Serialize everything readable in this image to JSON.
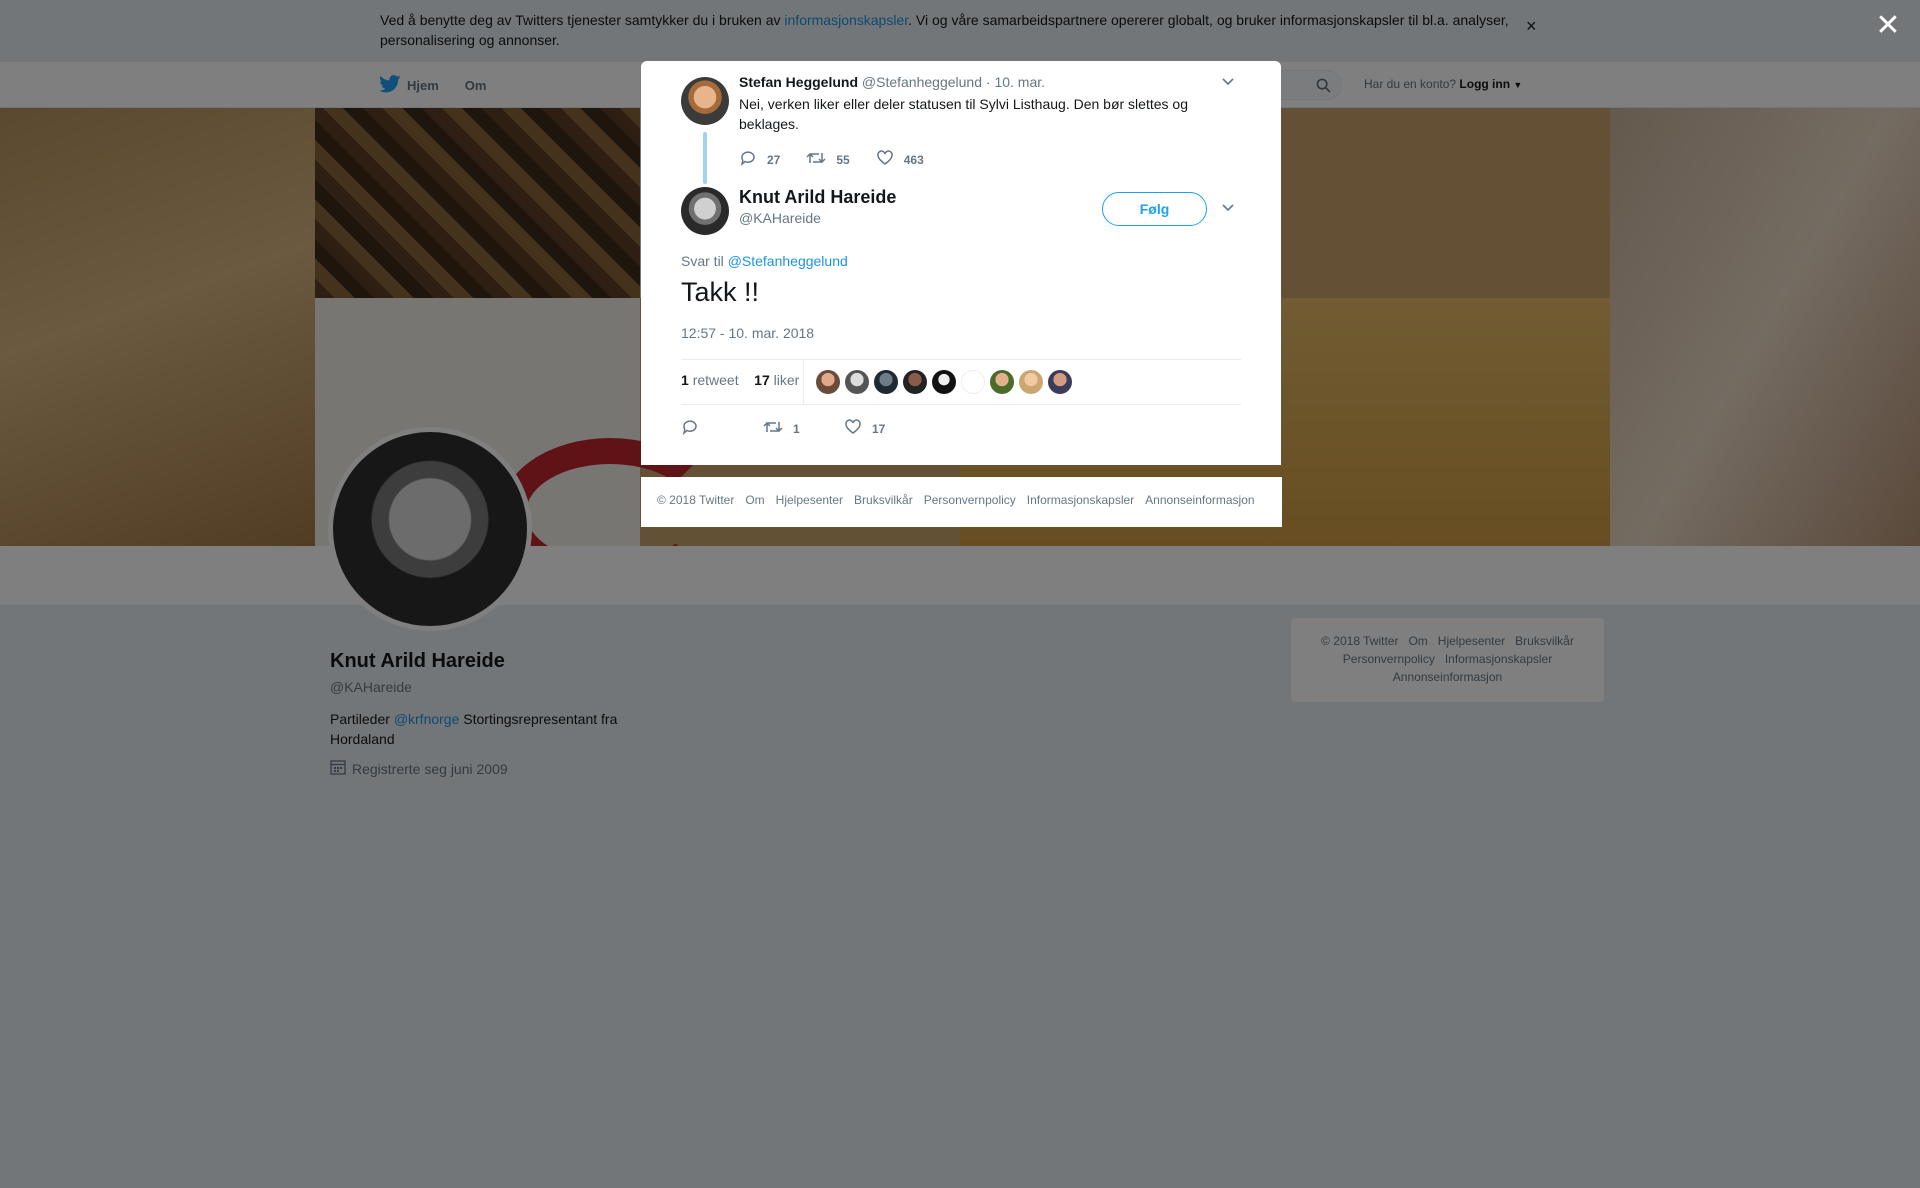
{
  "cookie_banner": {
    "text_before": "Ved å benytte deg av Twitters tjenester samtykker du i bruken av ",
    "link": "informasjonskapsler",
    "text_after": ". Vi og våre samarbeidspartnere opererer globalt, og bruker informasjonskapsler til bl.a. analyser, personalisering og annonser.",
    "close": "×"
  },
  "topnav": {
    "home": "Hjem",
    "about": "Om",
    "account_prompt": "Har du en konto?",
    "login": "Logg inn"
  },
  "profile": {
    "name": "Knut Arild Hareide",
    "handle": "@KAHareide",
    "bio_before": "Partileder ",
    "bio_link": "@krfnorge",
    "bio_after": " Stortingsrepresentant fra Hordaland",
    "joined": "Registrerte seg juni 2009"
  },
  "side_footer": {
    "links": [
      "© 2018 Twitter",
      "Om",
      "Hjelpesenter",
      "Bruksvilkår",
      "Personvernpolicy",
      "Informasjonskapsler",
      "Annonseinformasjon"
    ]
  },
  "modal": {
    "close": "✕",
    "parent_tweet": {
      "name": "Stefan Heggelund",
      "handle": "@Stefanheggelund",
      "date": "· 10. mar.",
      "text": "Nei, verken liker eller deler statusen til Sylvi Listhaug. Den bør slettes og beklages.",
      "replies": "27",
      "retweets": "55",
      "likes": "463"
    },
    "main_tweet": {
      "name": "Knut Arild Hareide",
      "handle": "@KAHareide",
      "follow": "Følg",
      "reply_prefix": "Svar til ",
      "reply_to": "@Stefanheggelund",
      "text": "Takk !!",
      "timestamp": "12:57 - 10. mar. 2018",
      "retweet_count": "1",
      "retweet_label": "retweet",
      "like_count": "17",
      "like_label": "liker",
      "action_retweets": "1",
      "action_likes": "17"
    },
    "footer_links": [
      "© 2018 Twitter",
      "Om",
      "Hjelpesenter",
      "Bruksvilkår",
      "Personvernpolicy",
      "Informasjonskapsler",
      "Annonseinformasjon"
    ]
  },
  "colors": {
    "accent": "#1da1f2",
    "link": "#1b95e0",
    "thread_line": "#a2d2f2",
    "muted": "#657786"
  }
}
